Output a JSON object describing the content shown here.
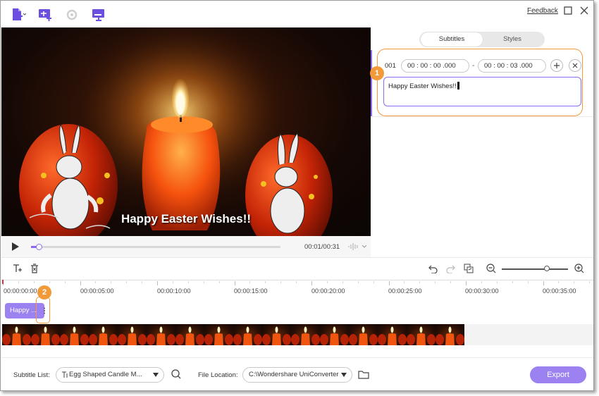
{
  "toolbar": {
    "icons": [
      "add-file-icon",
      "add-subtitle-icon",
      "refresh-icon",
      "screen-caption-icon"
    ],
    "feedback_label": "Feedback",
    "window_icons": [
      "maximize-icon",
      "close-icon"
    ]
  },
  "video": {
    "caption": "Happy Easter Wishes!!"
  },
  "player": {
    "timecode": "00:01/00:31",
    "progress_fraction": 0.02
  },
  "right_panel": {
    "tabs": [
      {
        "label": "Subtitles",
        "active": true
      },
      {
        "label": "Styles",
        "active": false
      }
    ],
    "subtitle": {
      "index": "001",
      "start": "00 : 00 : 00 .000",
      "dash": "-",
      "end": "00 : 00 : 03 .000",
      "text": "Happy Easter Wishes!!"
    }
  },
  "badges": [
    "1",
    "2"
  ],
  "timeline": {
    "tool_icons": [
      "add-text-icon",
      "delete-icon",
      "undo-icon",
      "redo-icon",
      "split-icon",
      "zoom-out-icon",
      "zoom-in-icon"
    ],
    "ruler_labels": [
      "00:00:00:00",
      "00:00:05:00",
      "00:00:10:00",
      "00:00:15:00",
      "00:00:20:00",
      "00:00:25:00",
      "00:00:30:00",
      "00:00:35:00"
    ],
    "clip_label": "Happy ..."
  },
  "footer": {
    "subtitle_list_label": "Subtitle List:",
    "subtitle_list_value": "Egg Shaped Candle M...",
    "file_location_label": "File Location:",
    "file_location_value": "C:\\Wondershare UniConverter",
    "export_label": "Export"
  },
  "colors": {
    "accent": "#8c6bf2",
    "highlight": "#f29a3a"
  }
}
